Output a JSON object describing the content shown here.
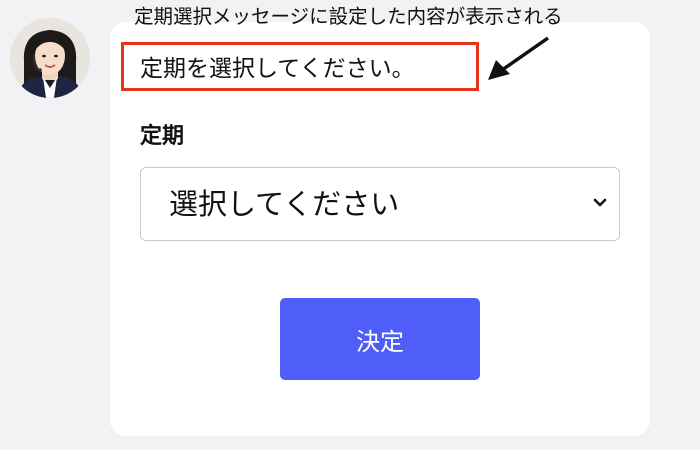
{
  "annotation": {
    "callout_text": "定期選択メッセージに設定した内容が表示される",
    "highlight_color": "#e8341c"
  },
  "chat": {
    "avatar": {
      "description_icon": "support-agent-with-headset"
    },
    "message": "定期を選択してください。"
  },
  "form": {
    "label": "定期",
    "select": {
      "selected_text": "選択してください",
      "icon": "chevron-down-icon"
    },
    "submit_label": "決定",
    "submit_color": "#4f5ef8"
  }
}
